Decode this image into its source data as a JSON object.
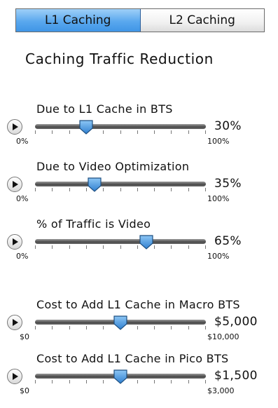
{
  "tabs": [
    {
      "label": "L1 Caching",
      "active": true
    },
    {
      "label": "L2 Caching",
      "active": false
    }
  ],
  "title": "Caching Traffic Reduction",
  "sliders": [
    {
      "label": "Due to L1 Cache in BTS",
      "value_text": "30%",
      "fraction": 0.3,
      "min": "0%",
      "max": "100%"
    },
    {
      "label": "Due to Video Optimization",
      "value_text": "35%",
      "fraction": 0.35,
      "min": "0%",
      "max": "100%"
    },
    {
      "label": "% of Traffic is Video",
      "value_text": "65%",
      "fraction": 0.65,
      "min": "0%",
      "max": "100%"
    },
    {
      "label": "Cost to Add L1 Cache in Macro BTS",
      "value_text": "$5,000",
      "fraction": 0.5,
      "min": "$0",
      "max": "$10,000"
    },
    {
      "label": "Cost to Add L1 Cache in Pico BTS",
      "value_text": "$1,500",
      "fraction": 0.5,
      "min": "$0",
      "max": "$3,000"
    }
  ],
  "colors": {
    "tab_active": "#5aa8ee",
    "thumb": "#2f7fd0"
  }
}
